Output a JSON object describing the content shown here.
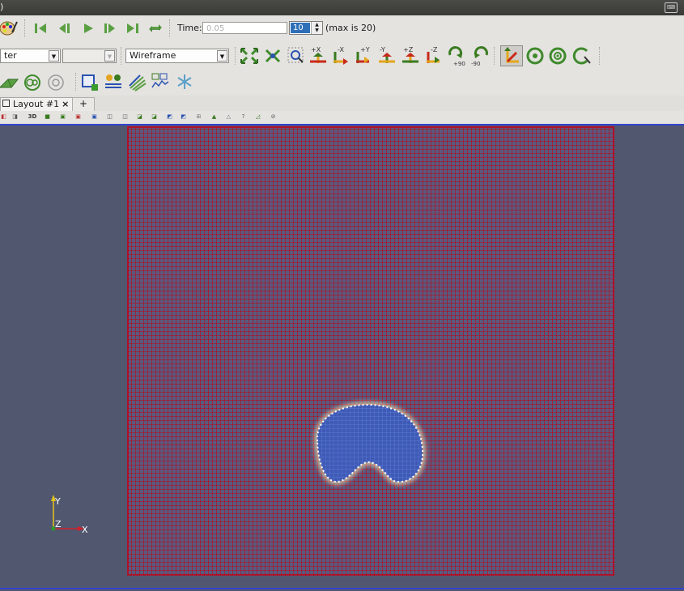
{
  "window": {
    "title_fragment": ")"
  },
  "toolbar_animation": {
    "time_label": "Time:",
    "time_value": "0.05",
    "timestep_value": "10",
    "max_label": "(max is 20)"
  },
  "toolbar_representation": {
    "filter_combo": "ter",
    "field_combo": "",
    "representation": "Wireframe"
  },
  "layout_tabs": {
    "tabs": [
      {
        "label": "Layout #1"
      }
    ],
    "close_glyph": "×",
    "add_glyph": "+"
  },
  "view_toolbar": {
    "mode_3d": "3D"
  },
  "viewport": {
    "background_color": "#525770",
    "mesh_color": "#a8182e",
    "blob_color": "#3f5ab5",
    "axes": {
      "y": "Y",
      "z": "Z",
      "x": "X"
    }
  },
  "icons": [
    "color-palette-icon",
    "first-frame-icon",
    "previous-frame-icon",
    "play-icon",
    "next-frame-icon",
    "last-frame-icon",
    "loop-icon",
    "reset-camera-icon",
    "zoom-to-data-icon",
    "zoom-to-box-icon",
    "view-plus-x-icon",
    "view-minus-x-icon",
    "view-plus-y-icon",
    "view-minus-y-icon",
    "view-plus-z-icon",
    "view-minus-z-icon",
    "rotate-plus-90-icon",
    "rotate-minus-90-icon",
    "show-orientation-axes-icon",
    "show-center-icon",
    "reset-center-icon",
    "pick-center-icon",
    "clip-icon",
    "contour-icon",
    "slice-icon",
    "extract-selection-icon",
    "calculator-icon",
    "stream-tracer-icon",
    "histogram-icon",
    "glyph-icon"
  ]
}
